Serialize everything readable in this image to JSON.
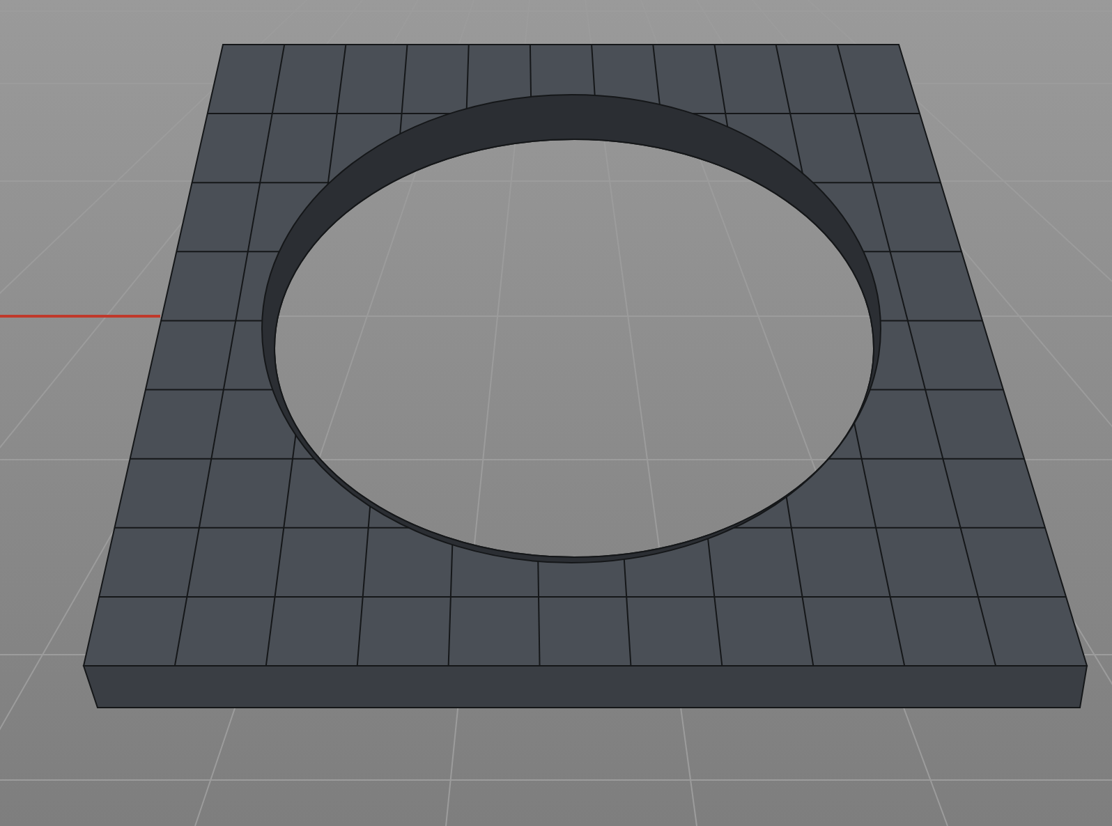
{
  "viewport": {
    "axis_visible": true,
    "wireframe_visible": true
  }
}
